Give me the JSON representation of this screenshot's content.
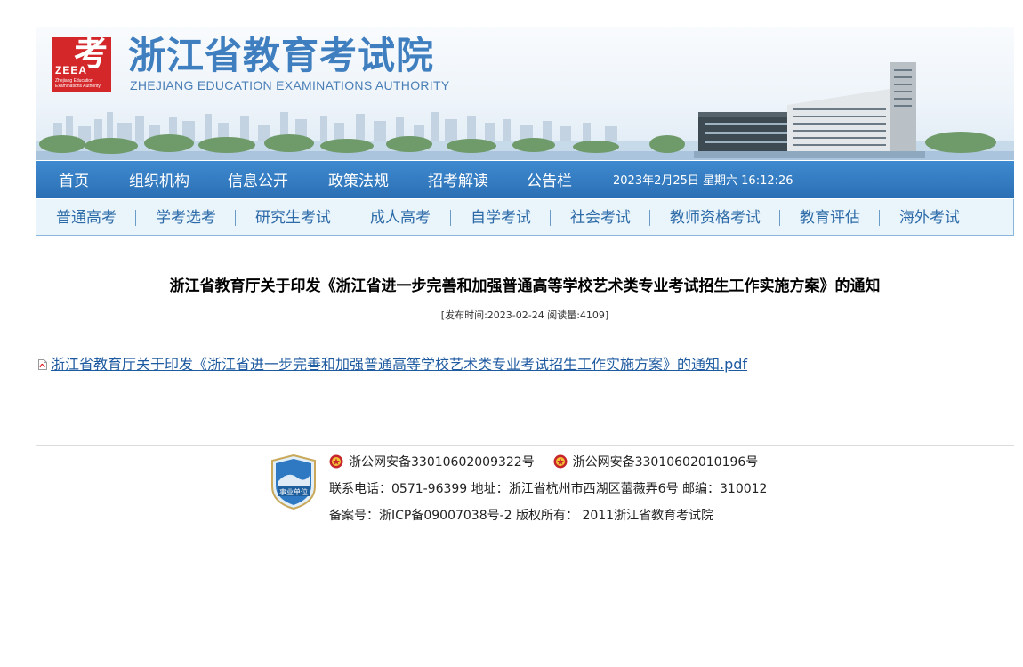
{
  "header": {
    "logo_text": "考",
    "logo_abbr": "ZEEA",
    "logo_small": "Zhejiang Education Examinations Authority",
    "title": "浙江省教育考试院",
    "subtitle": "ZHEJIANG EDUCATION EXAMINATIONS AUTHORITY"
  },
  "nav": {
    "items": [
      "首页",
      "组织机构",
      "信息公开",
      "政策法规",
      "招考解读",
      "公告栏"
    ],
    "datetime": "2023年2月25日 星期六 16:12:26"
  },
  "subnav": {
    "items": [
      "普通高考",
      "学考选考",
      "研究生考试",
      "成人高考",
      "自学考试",
      "社会考试",
      "教师资格考试",
      "教育评估",
      "海外考试"
    ]
  },
  "article": {
    "title": "浙江省教育厅关于印发《浙江省进一步完善和加强普通高等学校艺术类专业考试招生工作实施方案》的通知",
    "meta": "[发布时间:2023-02-24 阅读量:4109]",
    "attachment": "浙江省教育厅关于印发《浙江省进一步完善和加强普通高等学校艺术类专业考试招生工作实施方案》的通知.pdf"
  },
  "footer": {
    "badge_text": "事业单位",
    "beian1": "浙公网安备33010602009322号",
    "beian2": "浙公网安备33010602010196号",
    "contact": "联系电话：0571-96399 地址：浙江省杭州市西湖区蕾薇弄6号 邮编：310012",
    "icp": "备案号：浙ICP备09007038号-2 版权所有： 2011浙江省教育考试院"
  },
  "colors": {
    "nav_blue": "#2b6fb4",
    "title_blue": "#3f7fbf",
    "subnav_bg": "#eaf4fb",
    "link": "#1e5aa0",
    "logo_red": "#d3272a"
  }
}
